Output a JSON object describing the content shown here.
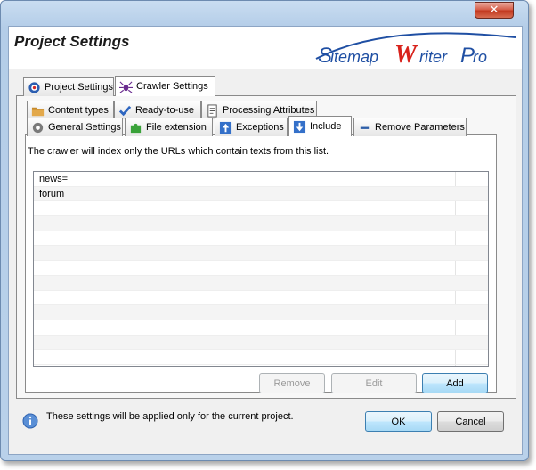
{
  "window": {
    "close_glyph": "✕",
    "title": "Project Settings",
    "logo_text": "SitemapWriterPro"
  },
  "outer_tabs": [
    {
      "label": "Project Settings",
      "icon": "gear-icon"
    },
    {
      "label": "Crawler Settings",
      "icon": "spider-icon",
      "active": true
    }
  ],
  "inner_tabs_row1": [
    {
      "label": "Content types",
      "icon": "folder-icon"
    },
    {
      "label": "Ready-to-use",
      "icon": "checkmark-icon"
    },
    {
      "label": "Processing Attributes",
      "icon": "document-icon"
    }
  ],
  "inner_tabs_row2": [
    {
      "label": "General Settings",
      "icon": "gear-icon"
    },
    {
      "label": "File extension",
      "icon": "puzzle-icon"
    },
    {
      "label": "Exceptions",
      "icon": "arrow-up-icon"
    },
    {
      "label": "Include",
      "icon": "arrow-down-icon",
      "active": true
    },
    {
      "label": "Remove Parameters",
      "icon": "minus-icon"
    }
  ],
  "include_panel": {
    "description": "The crawler will index only the URLs which contain texts from this list.",
    "items": [
      "news=",
      "forum"
    ],
    "buttons": {
      "remove": "Remove",
      "edit": "Edit",
      "add": "Add"
    }
  },
  "footer": {
    "info_icon": "info-icon",
    "note": "These settings will be applied only for the current project.",
    "ok": "OK",
    "cancel": "Cancel"
  },
  "colors": {
    "logo_blue": "#1f4fa3",
    "logo_red": "#d8231c",
    "frame": "#b9d1ea"
  }
}
